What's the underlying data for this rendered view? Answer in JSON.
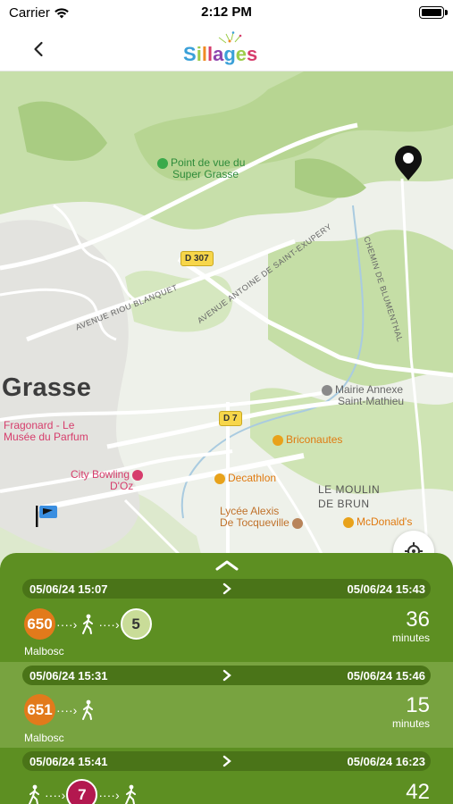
{
  "status_bar": {
    "carrier": "Carrier",
    "time": "2:12 PM"
  },
  "header": {
    "logo_text": "Sillages"
  },
  "map": {
    "city_label": "Grasse",
    "district_label_line1": "LE MOULIN",
    "district_label_line2": "DE BRUN",
    "pois": {
      "point_de_vue_l1": "Point de vue du",
      "point_de_vue_l2": "Super Grasse",
      "fragonard_l1": "Fragonard - Le",
      "fragonard_l2": "Musée du Parfum",
      "bowling_l1": "City Bowling",
      "bowling_l2": "D'Oz",
      "decathlon": "Decathlon",
      "briconautes": "Briconautes",
      "mairie_l1": "Mairie Annexe",
      "mairie_l2": "Saint-Mathieu",
      "lycee_l1": "Lycée Alexis",
      "lycee_l2": "De Tocqueville",
      "mcdonalds": "McDonald's"
    },
    "roads": {
      "d307": "D 307",
      "d7": "D 7",
      "riou": "AVENUE RIOU BLANQUET",
      "antoine": "AVENUE ANTOINE DE SAINT-EXUPERY",
      "blumenthal": "CHEMIN DE BLUMENTHAL"
    }
  },
  "trips": [
    {
      "departure": "05/06/24 15:07",
      "arrival": "05/06/24 15:43",
      "first_line": "650",
      "second_line": "5",
      "stop": "Malbosc",
      "duration": "36",
      "unit": "minutes"
    },
    {
      "departure": "05/06/24 15:31",
      "arrival": "05/06/24 15:46",
      "first_line": "651",
      "stop": "Malbosc",
      "duration": "15",
      "unit": "minutes"
    },
    {
      "departure": "05/06/24 15:41",
      "arrival": "05/06/24 16:23",
      "first_line": "7",
      "duration": "42"
    }
  ],
  "colors": {
    "sheet_green": "#5d8f22",
    "header_pill": "#4a7418",
    "line_650": "#e27a1b",
    "line_5": "#c9dc98",
    "line_7": "#b3184f"
  }
}
